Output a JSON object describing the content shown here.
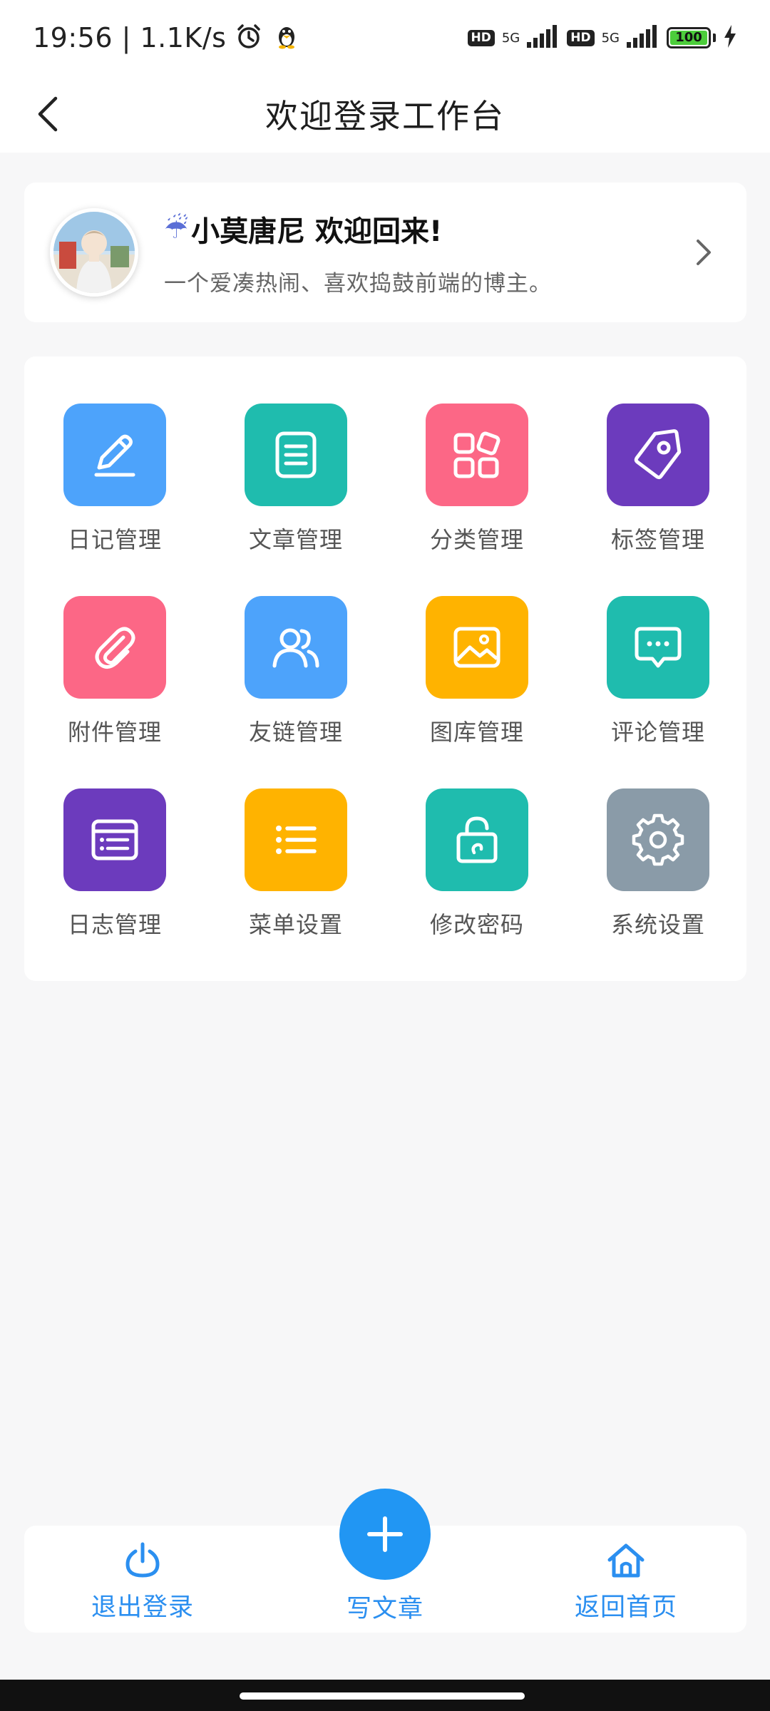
{
  "status_bar": {
    "time": "19:56 | 1.1K/s",
    "hd1": "HD",
    "net1": "5G",
    "hd2": "HD",
    "net2": "5G",
    "battery": "100"
  },
  "header": {
    "title": "欢迎登录工作台"
  },
  "user_card": {
    "name": "小莫唐尼 欢迎回来!",
    "emoji": "☔",
    "bio": "一个爱凑热闹、喜欢捣鼓前端的博主。"
  },
  "menu": {
    "items": [
      {
        "label": "日记管理",
        "color": "#4da3fb",
        "icon": "pencil-icon"
      },
      {
        "label": "文章管理",
        "color": "#1fbcae",
        "icon": "document-icon"
      },
      {
        "label": "分类管理",
        "color": "#fc6786",
        "icon": "category-grid-icon"
      },
      {
        "label": "标签管理",
        "color": "#6c3bbd",
        "icon": "tag-icon"
      },
      {
        "label": "附件管理",
        "color": "#fc6786",
        "icon": "paperclip-icon"
      },
      {
        "label": "友链管理",
        "color": "#4da3fb",
        "icon": "users-icon"
      },
      {
        "label": "图库管理",
        "color": "#ffb300",
        "icon": "image-icon"
      },
      {
        "label": "评论管理",
        "color": "#1fbcae",
        "icon": "comment-icon"
      },
      {
        "label": "日志管理",
        "color": "#6c3bbd",
        "icon": "log-window-icon"
      },
      {
        "label": "菜单设置",
        "color": "#ffb300",
        "icon": "list-icon"
      },
      {
        "label": "修改密码",
        "color": "#1fbcae",
        "icon": "lock-icon"
      },
      {
        "label": "系统设置",
        "color": "#8a9ba8",
        "icon": "gear-icon"
      }
    ]
  },
  "bottom_bar": {
    "logout_label": "退出登录",
    "write_label": "写文章",
    "home_label": "返回首页"
  },
  "colors": {
    "accent": "#2196f3",
    "bottom_text": "#2b8ff0"
  }
}
